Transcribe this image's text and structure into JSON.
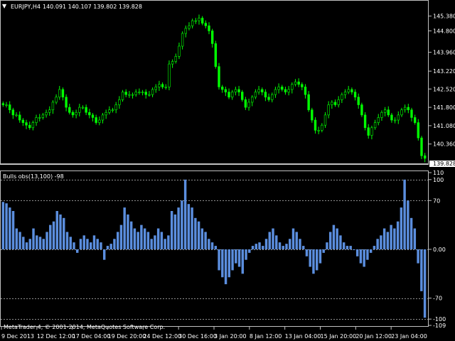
{
  "main_panel": {
    "symbol_label": "EURJPY,H4",
    "ohlc_label": "140.091 140.107 139.802 139.828",
    "current_price_label": "139.828",
    "price_ticks": [
      "145.380",
      "144.800",
      "143.960",
      "143.220",
      "142.520",
      "141.800",
      "141.080",
      "140.360"
    ]
  },
  "indicator_panel": {
    "label": "Bulls obs(13,100) -98",
    "level_ticks": [
      "110",
      "100",
      "70",
      "0.00",
      "-70",
      "-100",
      "-109"
    ]
  },
  "copyright": "MetaTrader 4, © 2001-2014, MetaQuotes Software Corp.",
  "time_axis": [
    "9 Dec 2013",
    "12 Dec 12:00",
    "17 Dec 04:00",
    "19 Dec 20:00",
    "24 Dec 12:00",
    "30 Dec 16:00",
    "3 Jan 20:00",
    "8 Jan 12:00",
    "13 Jan 04:00",
    "15 Jan 20:00",
    "20 Jan 12:00",
    "23 Jan 04:00"
  ],
  "colors": {
    "candle": "#00ff00",
    "histogram": "#5b8ede",
    "grid": "#c0c0c0",
    "text": "#ffffff",
    "background": "#000000"
  },
  "chart_data": [
    {
      "type": "candlestick",
      "symbol": "EURJPY",
      "timeframe": "H4",
      "y_range": [
        139.6,
        145.9
      ],
      "close_series": [
        141.9,
        141.9,
        141.7,
        141.5,
        141.5,
        141.3,
        141.2,
        141.1,
        141.0,
        141.2,
        141.4,
        141.4,
        141.5,
        141.6,
        141.7,
        142.0,
        142.2,
        142.5,
        142.2,
        141.8,
        141.6,
        141.5,
        141.6,
        141.8,
        141.8,
        141.6,
        141.5,
        141.4,
        141.2,
        141.3,
        141.5,
        141.6,
        141.7,
        141.7,
        141.9,
        142.1,
        142.4,
        142.3,
        142.3,
        142.3,
        142.4,
        142.4,
        142.4,
        142.3,
        142.3,
        142.5,
        142.6,
        142.7,
        142.6,
        142.6,
        143.5,
        143.6,
        143.8,
        144.2,
        144.7,
        144.9,
        145.0,
        145.2,
        145.2,
        145.3,
        145.1,
        145.0,
        144.8,
        144.3,
        143.4,
        142.6,
        142.5,
        142.4,
        142.2,
        142.4,
        142.5,
        142.4,
        142.1,
        141.8,
        142.0,
        142.2,
        142.4,
        142.5,
        142.4,
        142.2,
        142.1,
        142.3,
        142.5,
        142.6,
        142.5,
        142.4,
        142.5,
        142.7,
        142.8,
        142.7,
        142.6,
        142.3,
        141.7,
        141.3,
        140.9,
        140.9,
        141.1,
        141.5,
        141.9,
        142.0,
        141.9,
        142.1,
        142.3,
        142.4,
        142.5,
        142.4,
        142.2,
        141.9,
        141.5,
        141.0,
        140.7,
        141.0,
        141.2,
        141.4,
        141.6,
        141.7,
        141.5,
        141.3,
        141.3,
        141.5,
        141.7,
        141.8,
        141.7,
        141.4,
        141.2,
        140.6,
        139.9,
        139.8
      ]
    },
    {
      "type": "bar",
      "name": "Bulls obs(13,100)",
      "y_range": [
        -109,
        110
      ],
      "levels": [
        100,
        70,
        0,
        -70,
        -100
      ],
      "values": [
        68,
        66,
        60,
        55,
        30,
        25,
        18,
        10,
        15,
        30,
        20,
        18,
        15,
        25,
        35,
        40,
        55,
        50,
        45,
        25,
        18,
        10,
        -5,
        15,
        20,
        15,
        10,
        20,
        15,
        10,
        -15,
        5,
        8,
        15,
        25,
        35,
        60,
        50,
        40,
        30,
        25,
        35,
        30,
        25,
        15,
        20,
        30,
        25,
        15,
        20,
        55,
        50,
        60,
        70,
        100,
        65,
        60,
        45,
        40,
        30,
        25,
        15,
        10,
        5,
        -30,
        -40,
        -50,
        -40,
        -30,
        -20,
        -25,
        -35,
        -15,
        -5,
        5,
        8,
        10,
        5,
        15,
        25,
        30,
        20,
        10,
        5,
        8,
        15,
        30,
        25,
        15,
        5,
        -10,
        -25,
        -35,
        -30,
        -20,
        -5,
        10,
        25,
        35,
        30,
        20,
        10,
        5,
        5,
        0,
        -10,
        -20,
        -25,
        -15,
        -5,
        5,
        15,
        20,
        30,
        25,
        35,
        30,
        40,
        60,
        100,
        70,
        45,
        30,
        -20,
        -60,
        -98
      ]
    }
  ]
}
